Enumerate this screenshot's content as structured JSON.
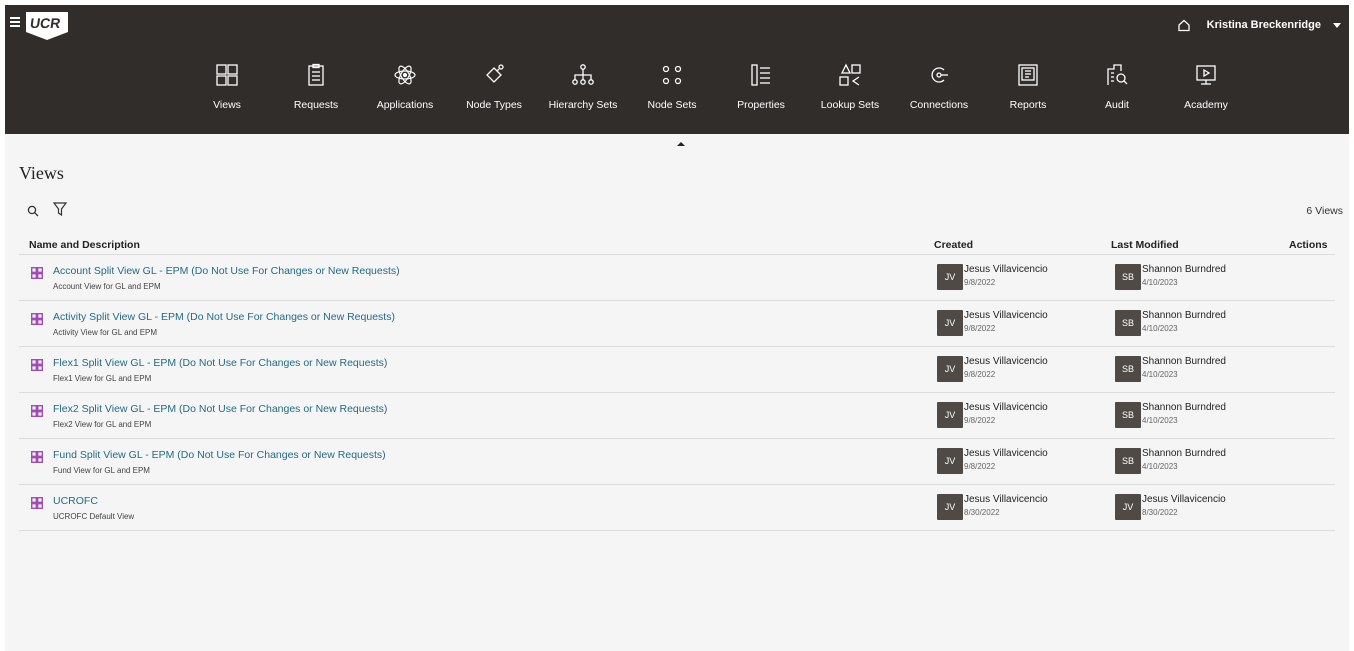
{
  "header": {
    "logo_text": "UCR",
    "user_name": "Kristina Breckenridge"
  },
  "nav": [
    {
      "label": "Views",
      "icon": "grid-icon"
    },
    {
      "label": "Requests",
      "icon": "clipboard-icon"
    },
    {
      "label": "Applications",
      "icon": "atom-icon"
    },
    {
      "label": "Node Types",
      "icon": "node-type-icon"
    },
    {
      "label": "Hierarchy Sets",
      "icon": "hierarchy-icon"
    },
    {
      "label": "Node Sets",
      "icon": "node-set-icon"
    },
    {
      "label": "Properties",
      "icon": "list-icon"
    },
    {
      "label": "Lookup Sets",
      "icon": "lookup-icon"
    },
    {
      "label": "Connections",
      "icon": "connection-icon"
    },
    {
      "label": "Reports",
      "icon": "report-icon"
    },
    {
      "label": "Audit",
      "icon": "audit-icon"
    },
    {
      "label": "Academy",
      "icon": "monitor-play-icon"
    }
  ],
  "page": {
    "title": "Views",
    "count": "6 Views"
  },
  "table": {
    "headers": {
      "name": "Name and Description",
      "created": "Created",
      "modified": "Last Modified",
      "actions": "Actions"
    },
    "rows": [
      {
        "name": "Account Split View GL - EPM   (Do Not Use For Changes or New Requests)",
        "desc": "Account View for GL and EPM",
        "created": {
          "initials": "JV",
          "name": "Jesus Villavicencio",
          "date": "9/8/2022"
        },
        "modified": {
          "initials": "SB",
          "name": "Shannon Burndred",
          "date": "4/10/2023"
        }
      },
      {
        "name": "Activity Split View GL - EPM   (Do Not Use For Changes or New Requests)",
        "desc": "Activity View for GL and EPM",
        "created": {
          "initials": "JV",
          "name": "Jesus Villavicencio",
          "date": "9/8/2022"
        },
        "modified": {
          "initials": "SB",
          "name": "Shannon Burndred",
          "date": "4/10/2023"
        }
      },
      {
        "name": "Flex1 Split View GL - EPM   (Do Not Use For Changes or New Requests)",
        "desc": "Flex1 View for GL and EPM",
        "created": {
          "initials": "JV",
          "name": "Jesus Villavicencio",
          "date": "9/8/2022"
        },
        "modified": {
          "initials": "SB",
          "name": "Shannon Burndred",
          "date": "4/10/2023"
        }
      },
      {
        "name": "Flex2 Split View GL - EPM   (Do Not Use For Changes or New Requests)",
        "desc": "Flex2 View for GL and EPM",
        "created": {
          "initials": "JV",
          "name": "Jesus Villavicencio",
          "date": "9/8/2022"
        },
        "modified": {
          "initials": "SB",
          "name": "Shannon Burndred",
          "date": "4/10/2023"
        }
      },
      {
        "name": "Fund Split View GL - EPM   (Do Not Use For Changes or New Requests)",
        "desc": "Fund View for GL and EPM",
        "created": {
          "initials": "JV",
          "name": "Jesus Villavicencio",
          "date": "9/8/2022"
        },
        "modified": {
          "initials": "SB",
          "name": "Shannon Burndred",
          "date": "4/10/2023"
        }
      },
      {
        "name": "UCROFC",
        "desc": "UCROFC Default View",
        "created": {
          "initials": "JV",
          "name": "Jesus Villavicencio",
          "date": "8/30/2022"
        },
        "modified": {
          "initials": "JV",
          "name": "Jesus Villavicencio",
          "date": "8/30/2022"
        }
      }
    ]
  },
  "colors": {
    "topbar": "#312d2a",
    "link": "#216c8a",
    "view_icon": "#a24cb8",
    "avatar": "#4f4a45"
  }
}
